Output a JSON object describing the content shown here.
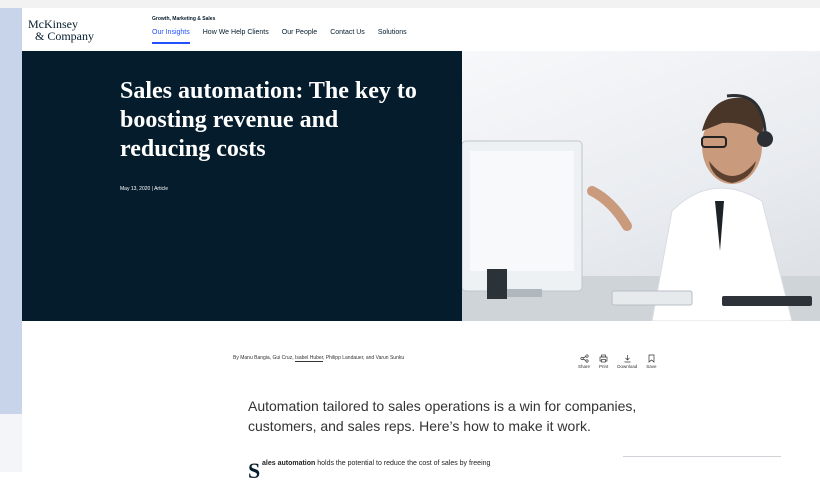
{
  "logo": {
    "line1": "McKinsey",
    "line2": "& Company"
  },
  "header": {
    "section": "Growth, Marketing & Sales"
  },
  "nav": {
    "items": [
      "Our Insights",
      "How We Help Clients",
      "Our People",
      "Contact Us",
      "Solutions"
    ],
    "active": "Our Insights"
  },
  "hero": {
    "title": "Sales automation: The key to boosting revenue and reducing costs",
    "meta": "May 13, 2020 | Article",
    "image_alt": "Man with headset working at computer"
  },
  "byline": {
    "prefix": "By Manu Bangia, Gui Cruz, ",
    "highlighted": "Isabel Huber",
    "suffix": ", Philipp Landauer, and Varun Sunku"
  },
  "tools": {
    "share": "Share",
    "print": "Print",
    "download": "Download",
    "save": "Save"
  },
  "article": {
    "lede": "Automation tailored to sales operations is a win for companies, customers, and sales reps. Here’s how to make it work.",
    "dropcap": "S",
    "body_bold": "ales automation",
    "body_rest": " holds the potential to reduce the cost of sales by freeing"
  },
  "colors": {
    "navy": "#051c2c",
    "accent": "#2251ff"
  }
}
